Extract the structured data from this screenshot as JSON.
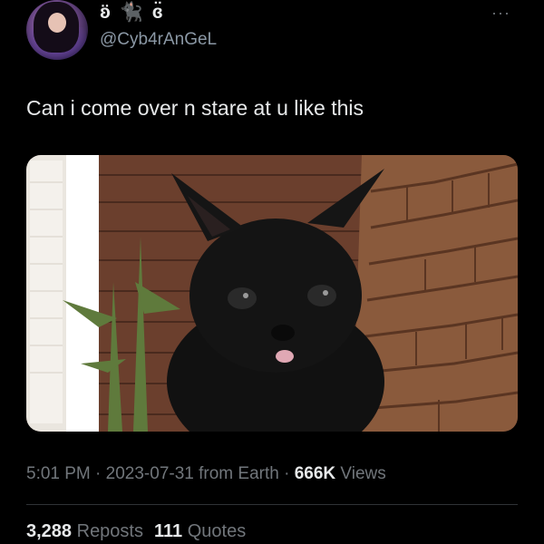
{
  "author": {
    "display_name": "ʚ̈ 🐈‍⬛ ɞ̈",
    "handle": "@Cyb4rAnGeL",
    "avatar_icon": "avatar-image"
  },
  "more_icon": "···",
  "tweet": {
    "text": "Can i come over n stare at u like this",
    "media_description_icon": "black-kitten-photo"
  },
  "meta": {
    "time": "5:01 PM",
    "sep1": " · ",
    "date": "2023-07-31",
    "source": " from Earth",
    "sep2": " · ",
    "views_count": "666K",
    "views_label": " Views"
  },
  "stats": {
    "reposts_count": "3,288",
    "reposts_label": " Reposts",
    "quotes_count": "111",
    "quotes_label": " Quotes"
  },
  "colors": {
    "background": "#000000",
    "text_primary": "#e7e9ea",
    "text_secondary": "#71767b",
    "divider": "#2f3336"
  }
}
